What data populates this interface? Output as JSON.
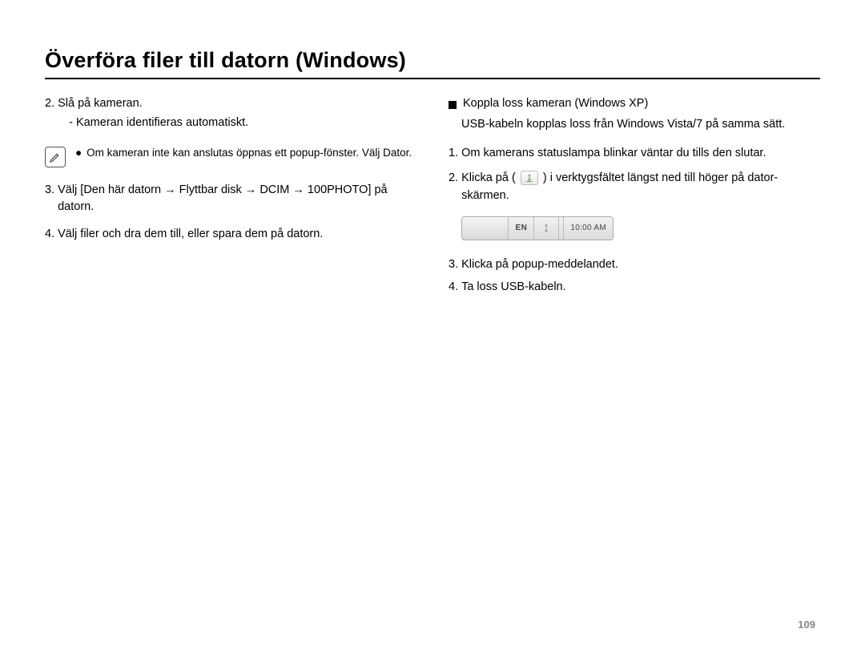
{
  "title": "Överföra filer till datorn (Windows)",
  "left": {
    "step2_num": "2.",
    "step2_text": "Slå på kameran.",
    "step2_sub": "- Kameran identifieras automatiskt.",
    "note_bullet": "●",
    "note_text": "Om kameran inte kan anslutas öppnas ett popup-fönster. Välj Dator.",
    "step3_num": "3.",
    "step3_text": "Välj [Den här datorn → Flyttbar disk → DCIM → 100PHOTO] på datorn.",
    "step4_num": "4.",
    "step4_text": "Välj filer och dra dem till, eller spara dem på datorn."
  },
  "right": {
    "heading": "Koppla loss kameran (Windows XP)",
    "heading_sub": "USB-kabeln kopplas loss från Windows Vista/7 på samma sätt.",
    "step1_num": "1.",
    "step1_text": "Om kamerans statuslampa blinkar väntar du tills den slutar.",
    "step2_num": "2.",
    "step2_pre": "Klicka på (",
    "step2_post": ") i verktygsfältet längst ned till höger på dator-skärmen.",
    "tray_lang": "EN",
    "tray_time": "10:00 AM",
    "step3_num": "3.",
    "step3_text": "Klicka på popup-meddelandet.",
    "step4_num": "4.",
    "step4_text": "Ta loss USB-kabeln."
  },
  "page_number": "109"
}
